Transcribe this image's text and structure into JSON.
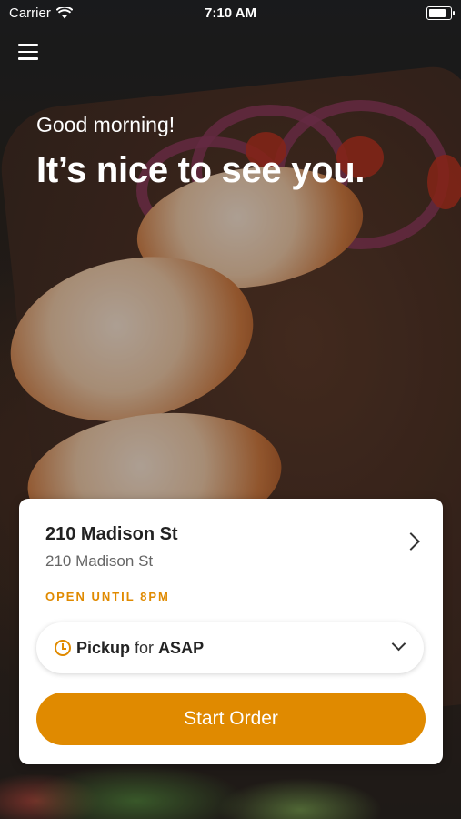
{
  "status_bar": {
    "carrier": "Carrier",
    "time": "7:10 AM",
    "battery_level": 0.9
  },
  "hero": {
    "greeting": "Good morning!",
    "headline": "It’s nice to see you."
  },
  "location_card": {
    "title": "210 Madison St",
    "subtitle": "210 Madison St",
    "status": "OPEN UNTIL 8PM",
    "order_type": "Pickup",
    "for_label": "for",
    "time_option": "ASAP",
    "start_button_label": "Start Order"
  },
  "colors": {
    "accent": "#E08A00",
    "card_background": "#FFFFFF",
    "primary_text": "#222222",
    "secondary_text": "#666666"
  },
  "icons": {
    "menu": "hamburger-menu-icon",
    "wifi": "wifi-icon",
    "battery": "battery-icon",
    "chevron_right": "chevron-right-icon",
    "clock": "clock-icon",
    "chevron_down": "chevron-down-icon"
  }
}
